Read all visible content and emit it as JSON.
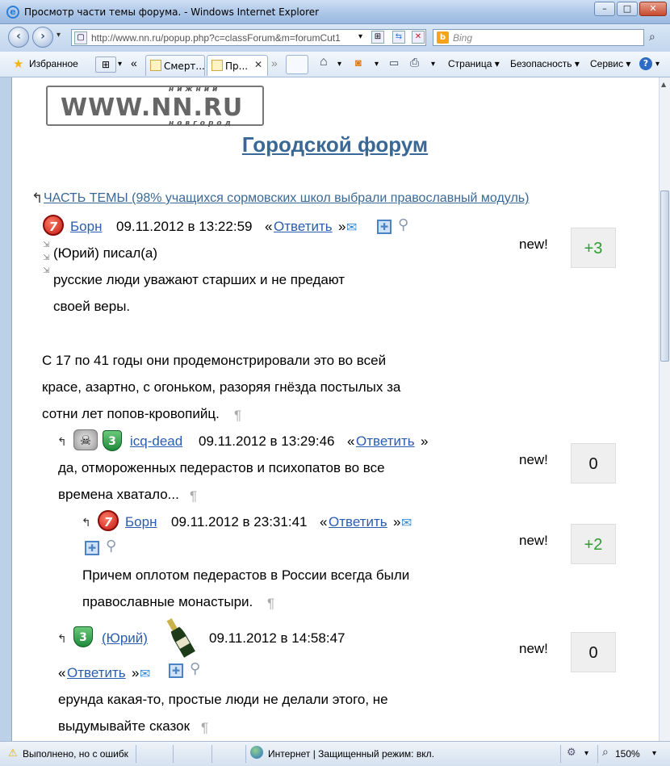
{
  "window": {
    "title": "Просмотр части темы форума. - Windows Internet Explorer",
    "minimize": "–",
    "maximize": "□",
    "close": "✕"
  },
  "address": {
    "url": "http://www.nn.ru/popup.php?c=classForum&m=forumCut1",
    "search_placeholder": "Bing"
  },
  "toolbar": {
    "favorites": "Избранное",
    "tabs": [
      "Смерт...",
      "Пр..."
    ],
    "page": "Страница",
    "security": "Безопасность",
    "tools": "Сервис"
  },
  "page": {
    "logo": {
      "main": "WWW.NN.RU",
      "top": "нижний",
      "bottom": "новгород"
    },
    "forum_title": "Городской форум",
    "topic_link": "ЧАСТЬ ТЕМЫ (98% учащихся сормовских школ выбрали православный модуль)"
  },
  "posts": [
    {
      "author": "Борн",
      "date": "09.11.2012 в 13:22:59",
      "reply": "Ответить",
      "quote_author": "(Юрий) писал(а)",
      "quote_lines": [
        "русские люди уважают старших и не предают",
        "своей веры."
      ],
      "lines": [
        "С 17 по 41 годы они продемонстрировали это во всей",
        "красе, азартно, с огоньком, разоряя гнёзда постылых за",
        "сотни лет попов-кровопийц."
      ],
      "new_label": "new!",
      "score": "+3"
    },
    {
      "author": "icq-dead",
      "date": "09.11.2012 в 13:29:46",
      "reply": "Ответить",
      "lines": [
        "да, отмороженных педерастов и психопатов во все",
        "времена хватало..."
      ],
      "new_label": "new!",
      "score": "0"
    },
    {
      "author": "Борн",
      "date": "09.11.2012 в 23:31:41",
      "reply": "Ответить",
      "lines": [
        "Причем оплотом педерастов в России всегда были",
        "православные монастыри."
      ],
      "new_label": "new!",
      "score": "+2"
    },
    {
      "author": "(Юрий)",
      "date": "09.11.2012 в 14:58:47",
      "reply": "Ответить",
      "lines": [
        "ерунда какая-то, простые люди не делали этого, не",
        "выдумывайте сказок"
      ],
      "new_label": "new!",
      "score": "0"
    }
  ],
  "badges": {
    "seven": "7",
    "three": "3"
  },
  "glyphs": {
    "pilcrow": "¶",
    "quote_open": "«",
    "quote_close": "»"
  },
  "statusbar": {
    "left": "Выполнено, но с ошибк",
    "zone": "Интернет | Защищенный режим: вкл.",
    "zoom": "150%"
  },
  "colors": {
    "link": "#2a5db0",
    "title": "#3a6896",
    "positive": "#2e9c2e"
  }
}
